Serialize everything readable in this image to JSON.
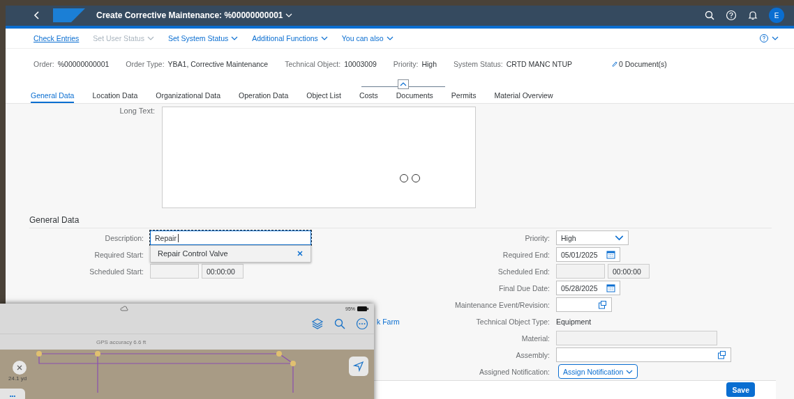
{
  "shell": {
    "title": "Create Corrective Maintenance: %00000000001",
    "avatar": "E"
  },
  "toolbar": [
    {
      "label": "Check Entries",
      "kind": "link",
      "disabled": false
    },
    {
      "label": "Set User Status",
      "kind": "menu",
      "disabled": true
    },
    {
      "label": "Set System Status",
      "kind": "menu",
      "disabled": false
    },
    {
      "label": "Additional Functions",
      "kind": "menu",
      "disabled": false
    },
    {
      "label": "You can also",
      "kind": "menu",
      "disabled": false
    }
  ],
  "header": {
    "fields": [
      {
        "label": "Order:",
        "value": "%00000000001"
      },
      {
        "label": "Order Type:",
        "value": "YBA1, Corrective Maintenance"
      },
      {
        "label": "Technical Object:",
        "value": "10003009"
      },
      {
        "label": "Priority:",
        "value": "High"
      },
      {
        "label": "System Status:",
        "value": "CRTD MANC NTUP"
      }
    ],
    "documents": "0 Document(s)"
  },
  "tabs": [
    {
      "label": "General Data",
      "selected": true
    },
    {
      "label": "Location Data",
      "selected": false
    },
    {
      "label": "Organizational Data",
      "selected": false
    },
    {
      "label": "Operation Data",
      "selected": false
    },
    {
      "label": "Object List",
      "selected": false
    },
    {
      "label": "Costs",
      "selected": false
    },
    {
      "label": "Documents",
      "selected": false
    },
    {
      "label": "Permits",
      "selected": false
    },
    {
      "label": "Material Overview",
      "selected": false
    }
  ],
  "long_text": {
    "label": "Long Text:"
  },
  "section_title": "General Data",
  "form": {
    "left": [
      {
        "label": "Description:",
        "kind": "text_input",
        "value": "Repair",
        "focused": true,
        "suggestion": "Repair Control Valve"
      },
      {
        "label": "Required Start:",
        "kind": "none"
      },
      {
        "label": "Scheduled Start:",
        "kind": "datetime",
        "time": "00:00:00",
        "disabled": true
      },
      {
        "kind": "none"
      },
      {
        "kind": "none"
      },
      {
        "kind": "link",
        "value": "k Farm"
      }
    ],
    "right": [
      {
        "label": "Priority:",
        "kind": "select",
        "value": "High"
      },
      {
        "label": "Required End:",
        "kind": "date",
        "value": "05/01/2025"
      },
      {
        "label": "Scheduled End:",
        "kind": "datetime",
        "time": "00:00:00",
        "disabled": true
      },
      {
        "label": "Final Due Date:",
        "kind": "date",
        "value": "05/28/2025"
      },
      {
        "label": "Maintenance Event/Revision:",
        "kind": "value_help"
      },
      {
        "label": "Technical Object Type:",
        "kind": "text",
        "value": "Equipment"
      },
      {
        "label": "Material:",
        "kind": "text_input",
        "disabled": true
      },
      {
        "label": "Assembly:",
        "kind": "value_help"
      },
      {
        "label": "Assigned Notification:",
        "kind": "button",
        "value": "Assign Notification"
      }
    ]
  },
  "footer": {
    "save": "Save"
  },
  "tablet": {
    "battery": "95%",
    "gps": "GPS accuracy 6.6 ft",
    "scale": "24.1 yd",
    "more": "•••"
  }
}
